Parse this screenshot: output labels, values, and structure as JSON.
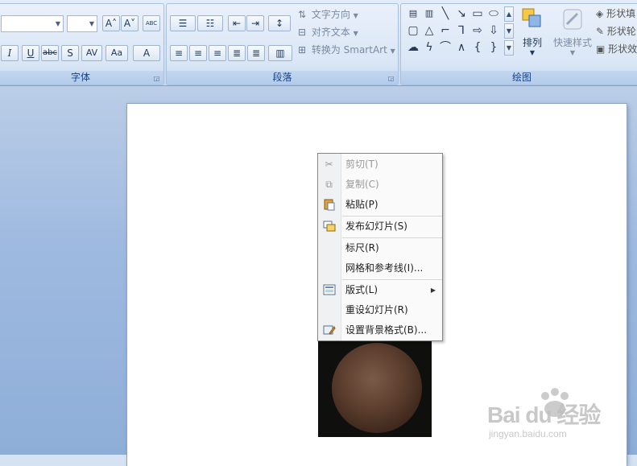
{
  "ribbon": {
    "font_group": {
      "label": "字体",
      "grow_font": "A˄",
      "shrink_font": "A˅",
      "clear_format": "ABC",
      "italic": "I",
      "underline": "U",
      "strikethrough": "abc",
      "shadow": "S",
      "char_spacing": "AV",
      "change_case": "Aa",
      "font_color": "A"
    },
    "paragraph_group": {
      "label": "段落",
      "text_direction": "文字方向",
      "align_text": "对齐文本",
      "convert_smartart": "转换为 SmartArt"
    },
    "drawing_group": {
      "label": "绘图",
      "arrange": "排列",
      "quick_styles": "快速样式",
      "shape_fill": "形状填",
      "shape_outline": "形状轮",
      "shape_effects": "形状效"
    }
  },
  "context_menu": {
    "items": [
      {
        "label": "剪切(T)",
        "icon": "scissors-icon",
        "enabled": false
      },
      {
        "label": "复制(C)",
        "icon": "copy-icon",
        "enabled": false
      },
      {
        "label": "粘贴(P)",
        "icon": "paste-icon",
        "enabled": true
      },
      {
        "label": "发布幻灯片(S)",
        "icon": "publish-slides-icon",
        "enabled": true
      },
      {
        "label": "标尺(R)",
        "icon": "",
        "enabled": true
      },
      {
        "label": "网格和参考线(I)...",
        "icon": "",
        "enabled": true
      },
      {
        "label": "版式(L)",
        "icon": "layout-icon",
        "enabled": true,
        "submenu": true
      },
      {
        "label": "重设幻灯片(R)",
        "icon": "",
        "enabled": true
      },
      {
        "label": "设置背景格式(B)...",
        "icon": "format-background-icon",
        "enabled": true
      }
    ]
  },
  "watermark": {
    "brand": "Bai du 经验",
    "url": "jingyan.baidu.com"
  }
}
